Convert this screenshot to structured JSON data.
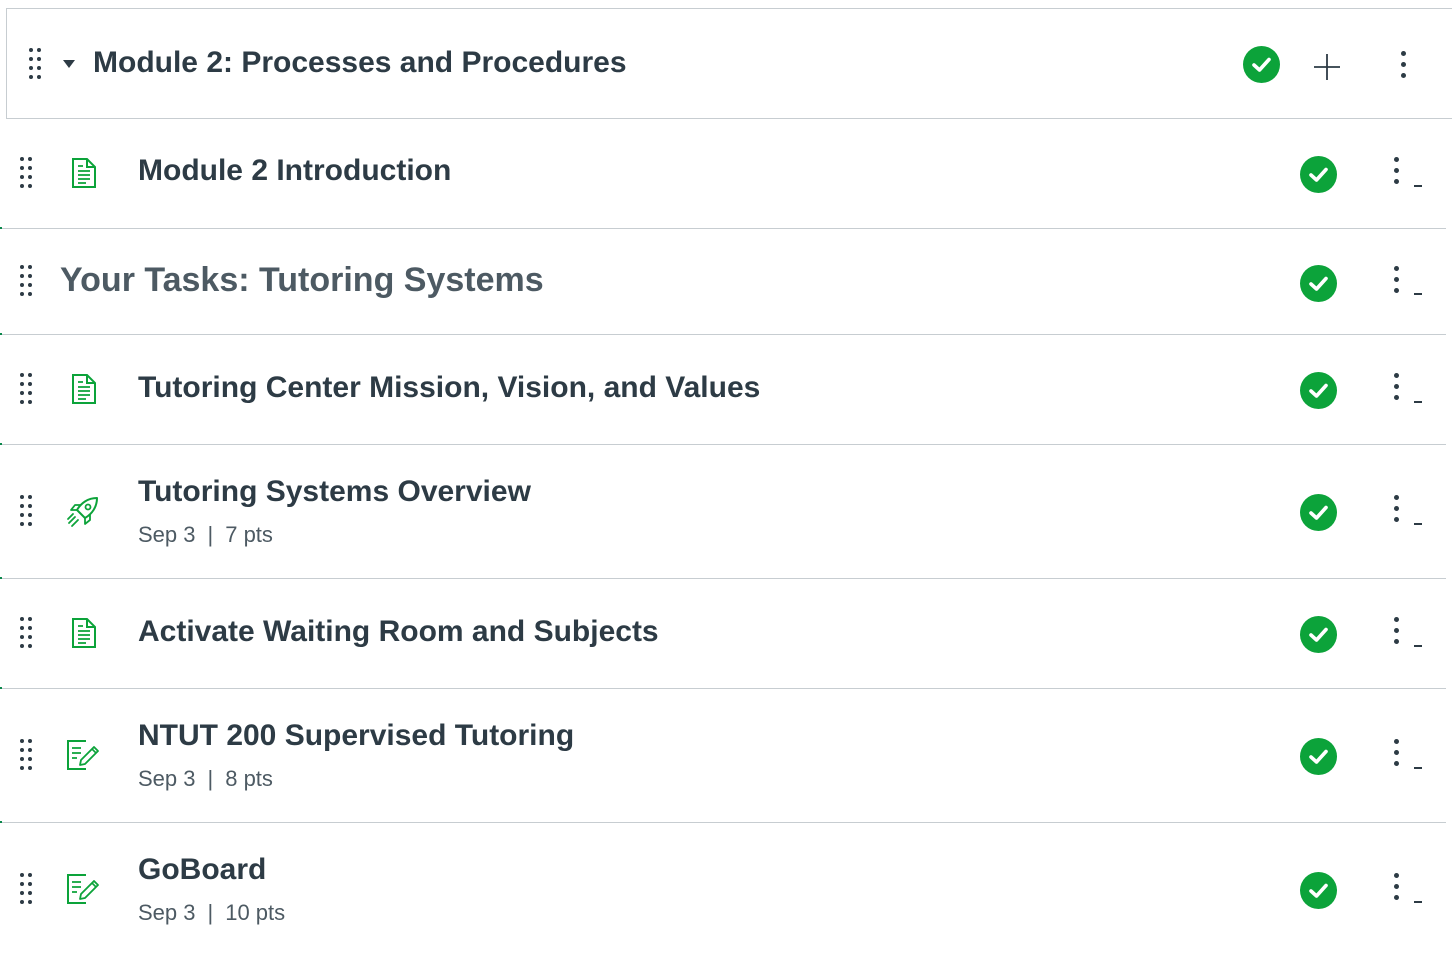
{
  "module": {
    "title": "Module 2: Processes and Procedures",
    "status": "published",
    "add_label": "+",
    "accent_color": "#0b874b",
    "check_color": "#0ca33a"
  },
  "items": [
    {
      "type": "page",
      "icon": "document-icon",
      "title": "Module 2 Introduction",
      "status": "published"
    },
    {
      "type": "subheader",
      "title": "Your Tasks: Tutoring Systems",
      "status": "published"
    },
    {
      "type": "page",
      "icon": "document-icon",
      "title": "Tutoring Center Mission, Vision, and Values",
      "status": "published"
    },
    {
      "type": "quiz",
      "icon": "rocket-icon",
      "title": "Tutoring Systems Overview",
      "due": "Sep 3",
      "sep": "|",
      "points": "7 pts",
      "status": "published"
    },
    {
      "type": "page",
      "icon": "document-icon",
      "title": "Activate Waiting Room and Subjects",
      "status": "published"
    },
    {
      "type": "assignment",
      "icon": "assignment-icon",
      "title": "NTUT 200 Supervised Tutoring",
      "due": "Sep 3",
      "sep": "|",
      "points": "8 pts",
      "status": "published"
    },
    {
      "type": "assignment",
      "icon": "assignment-icon",
      "title": "GoBoard",
      "due": "Sep 3",
      "sep": "|",
      "points": "10 pts",
      "status": "published"
    }
  ]
}
